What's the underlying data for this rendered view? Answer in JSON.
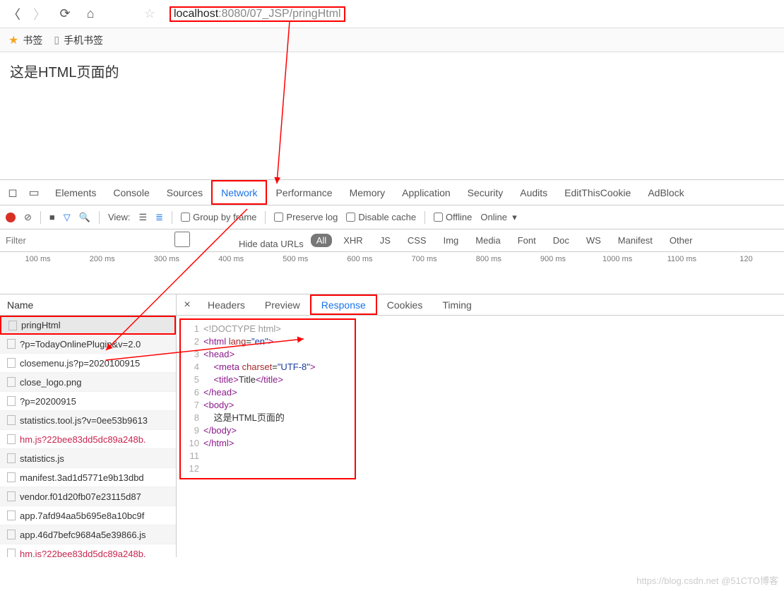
{
  "url": {
    "host": "localhost",
    "rest": ":8080/07_JSP/pringHtml"
  },
  "bookmarks": [
    "书签",
    "手机书签"
  ],
  "page_text": "这是HTML页面的",
  "devtools_tabs": [
    "Elements",
    "Console",
    "Sources",
    "Network",
    "Performance",
    "Memory",
    "Application",
    "Security",
    "Audits",
    "EditThisCookie",
    "AdBlock"
  ],
  "active_devtools_tab": "Network",
  "toolbar": {
    "view_label": "View:",
    "group_by_frame": "Group by frame",
    "preserve_log": "Preserve log",
    "disable_cache": "Disable cache",
    "offline": "Offline",
    "online": "Online"
  },
  "filter": {
    "placeholder": "Filter",
    "hide_data_urls": "Hide data URLs",
    "chips": [
      "All",
      "XHR",
      "JS",
      "CSS",
      "Img",
      "Media",
      "Font",
      "Doc",
      "WS",
      "Manifest",
      "Other"
    ]
  },
  "timeline_ticks": [
    "100 ms",
    "200 ms",
    "300 ms",
    "400 ms",
    "500 ms",
    "600 ms",
    "700 ms",
    "800 ms",
    "900 ms",
    "1000 ms",
    "1100 ms",
    "120"
  ],
  "request_list_header": "Name",
  "requests": [
    {
      "name": "pringHtml",
      "selected": true
    },
    {
      "name": "?p=TodayOnlinePlugin&v=2.0"
    },
    {
      "name": "closemenu.js?p=2020100915"
    },
    {
      "name": "close_logo.png"
    },
    {
      "name": "?p=20200915"
    },
    {
      "name": "statistics.tool.js?v=0ee53b9613"
    },
    {
      "name": "hm.js?22bee83dd5dc89a248b.",
      "red": true
    },
    {
      "name": "statistics.js"
    },
    {
      "name": "manifest.3ad1d5771e9b13dbd"
    },
    {
      "name": "vendor.f01d20fb07e23115d87"
    },
    {
      "name": "app.7afd94aa5b695e8a10bc9f"
    },
    {
      "name": "app.46d7befc9684a5e39866.js"
    },
    {
      "name": "hm.js?22bee83dd5dc89a248b.",
      "red": true
    }
  ],
  "detail_tabs": [
    "Headers",
    "Preview",
    "Response",
    "Cookies",
    "Timing"
  ],
  "active_detail_tab": "Response",
  "response_lines": [
    {
      "n": 1,
      "html": "<span class='t-gray'>&lt;!DOCTYPE html&gt;</span>"
    },
    {
      "n": 2,
      "html": "<span class='t-tag'>&lt;html</span> <span class='t-attr'>lang</span>=<span class='t-val'>\"en\"</span><span class='t-tag'>&gt;</span>"
    },
    {
      "n": 3,
      "html": "<span class='t-tag'>&lt;head&gt;</span>"
    },
    {
      "n": 4,
      "html": "&nbsp;&nbsp;&nbsp;&nbsp;<span class='t-tag'>&lt;meta</span> <span class='t-attr'>charset</span>=<span class='t-val'>\"UTF-8\"</span><span class='t-tag'>&gt;</span>"
    },
    {
      "n": 5,
      "html": "&nbsp;&nbsp;&nbsp;&nbsp;<span class='t-tag'>&lt;title&gt;</span>Title<span class='t-tag'>&lt;/title&gt;</span>"
    },
    {
      "n": 6,
      "html": "<span class='t-tag'>&lt;/head&gt;</span>"
    },
    {
      "n": 7,
      "html": "<span class='t-tag'>&lt;body&gt;</span>"
    },
    {
      "n": 8,
      "html": "&nbsp;&nbsp;&nbsp;&nbsp;这是HTML页面的"
    },
    {
      "n": 9,
      "html": "<span class='t-tag'>&lt;/body&gt;</span>"
    },
    {
      "n": 10,
      "html": "<span class='t-tag'>&lt;/html&gt;</span>"
    },
    {
      "n": 11,
      "html": ""
    },
    {
      "n": 12,
      "html": ""
    }
  ],
  "watermark": "https://blog.csdn.net @51CTO博客"
}
